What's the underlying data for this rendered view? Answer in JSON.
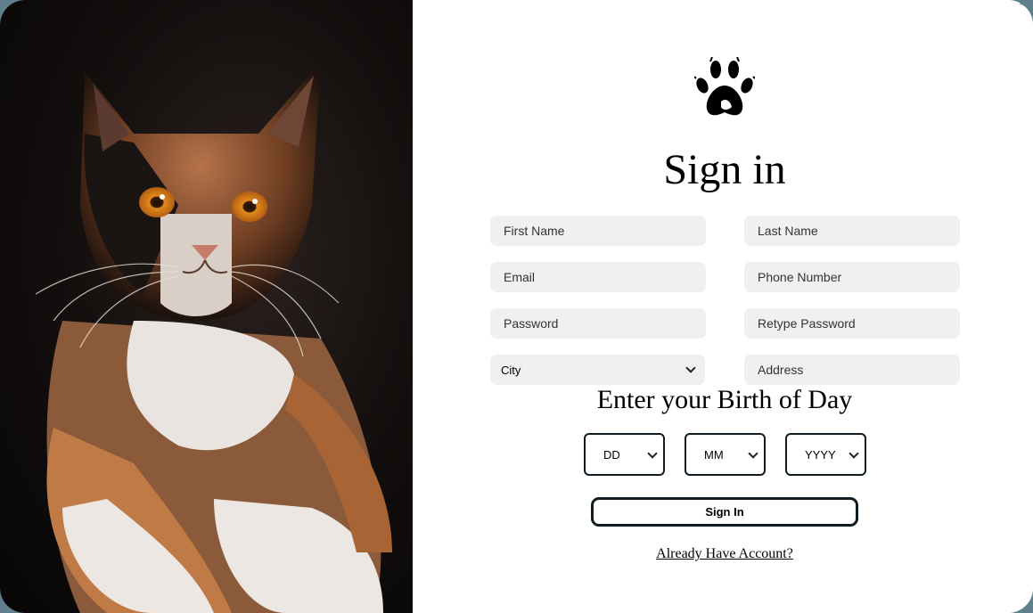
{
  "form": {
    "title": "Sign in",
    "first_name_placeholder": "First Name",
    "last_name_placeholder": "Last Name",
    "email_placeholder": "Email",
    "phone_placeholder": "Phone Number",
    "password_placeholder": "Password",
    "retype_password_placeholder": "Retype Password",
    "city_value": "City",
    "address_placeholder": "Address",
    "dob_title": "Enter your Birth of Day",
    "dob_day": "DD",
    "dob_month": "MM",
    "dob_year": "YYYY",
    "submit_label": "Sign In",
    "account_link": "Already Have Account?"
  },
  "icons": {
    "logo": "paw-print-icon",
    "dropdown": "chevron-down-icon"
  },
  "colors": {
    "field_background": "#eef0f1",
    "button_border": "#111c22",
    "page_background": "#5f7f8c"
  }
}
